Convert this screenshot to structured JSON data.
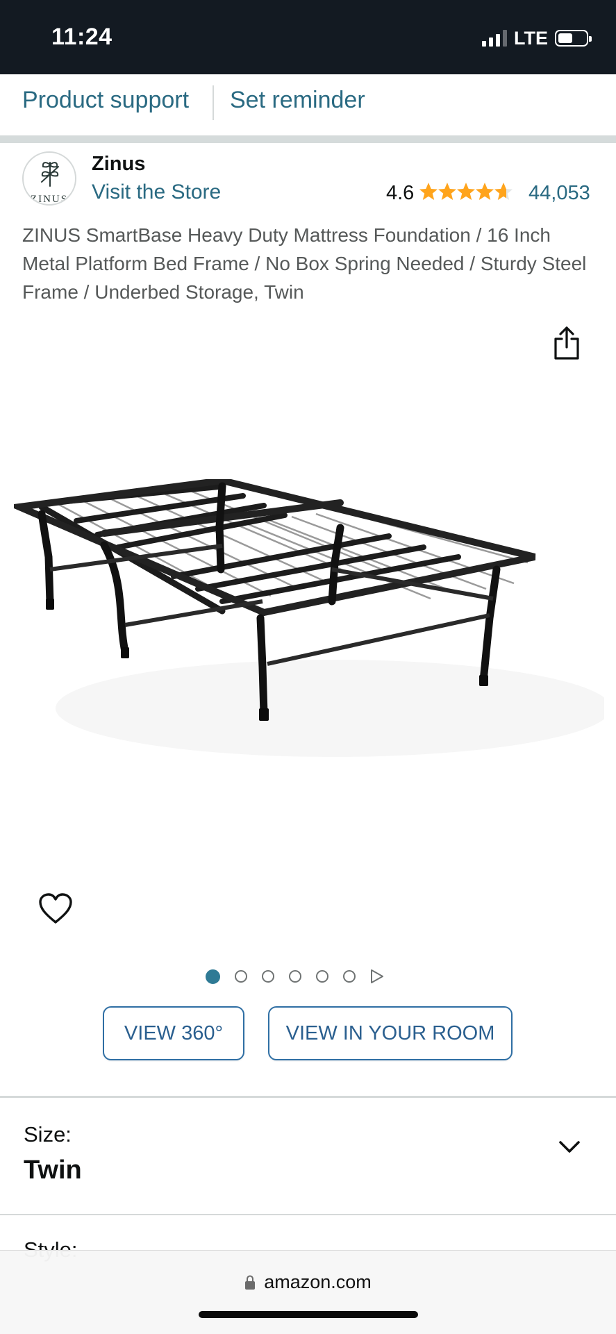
{
  "status_bar": {
    "time": "11:24",
    "network": "LTE"
  },
  "nav": {
    "product_support": "Product support",
    "set_reminder": "Set reminder"
  },
  "brand": {
    "logo_text": "ZINUS",
    "name": "Zinus",
    "visit_store": "Visit the Store",
    "rating": "4.6",
    "rating_count": "44,053",
    "star_fraction": 0.92
  },
  "product": {
    "title": "ZINUS SmartBase Heavy Duty Mattress Foundation / 16 Inch Metal Platform Bed Frame / No Box Spring Needed / Sturdy Steel Frame / Underbed Storage, Twin",
    "image_count": 6,
    "active_image": 1
  },
  "actions": {
    "view_360": "VIEW 360°",
    "view_in_room": "VIEW IN YOUR ROOM"
  },
  "options": {
    "size_label": "Size:",
    "size_value": "Twin",
    "style_label": "Style:"
  },
  "browser": {
    "url": "amazon.com"
  },
  "colors": {
    "link": "#2a6a82",
    "star": "#ffa41c",
    "status_bar": "#131a22",
    "button_border": "#2f6fa4"
  },
  "icons": {
    "share": "share-icon",
    "wishlist": "heart-icon",
    "expand": "chevron-down-icon",
    "lock": "lock-icon",
    "video": "play-icon"
  }
}
